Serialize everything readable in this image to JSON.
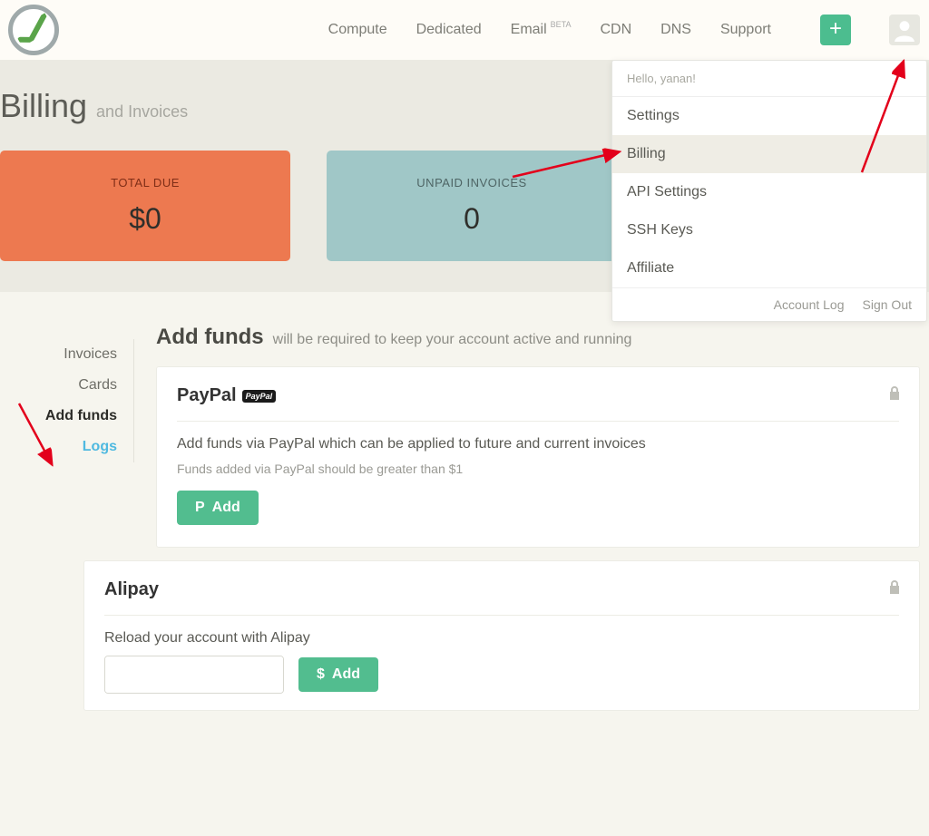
{
  "nav": {
    "items": [
      "Compute",
      "Dedicated",
      "Email",
      "CDN",
      "DNS",
      "Support"
    ],
    "beta": "BETA",
    "plus": "+"
  },
  "dropdown": {
    "hello": "Hello, yanan!",
    "items": [
      "Settings",
      "Billing",
      "API Settings",
      "SSH Keys",
      "Affiliate"
    ],
    "footer": [
      "Account Log",
      "Sign Out"
    ]
  },
  "title": {
    "main": "Billing",
    "sub": "and Invoices"
  },
  "stats": {
    "total_due": {
      "label": "TOTAL DUE",
      "value": "$0"
    },
    "unpaid": {
      "label": "UNPAID INVOICES",
      "value": "0"
    }
  },
  "sidetabs": [
    "Invoices",
    "Cards",
    "Add funds",
    "Logs"
  ],
  "section": {
    "title": "Add funds",
    "sub": "will be required to keep your account active and running"
  },
  "paypal": {
    "title": "PayPal",
    "badge": "PayPal",
    "desc": "Add funds via PayPal which can be applied to future and current invoices",
    "note": "Funds added via PayPal should be greater than $1",
    "button": "Add"
  },
  "alipay": {
    "title": "Alipay",
    "desc": "Reload your account with Alipay",
    "currency": "$",
    "button": "Add"
  }
}
